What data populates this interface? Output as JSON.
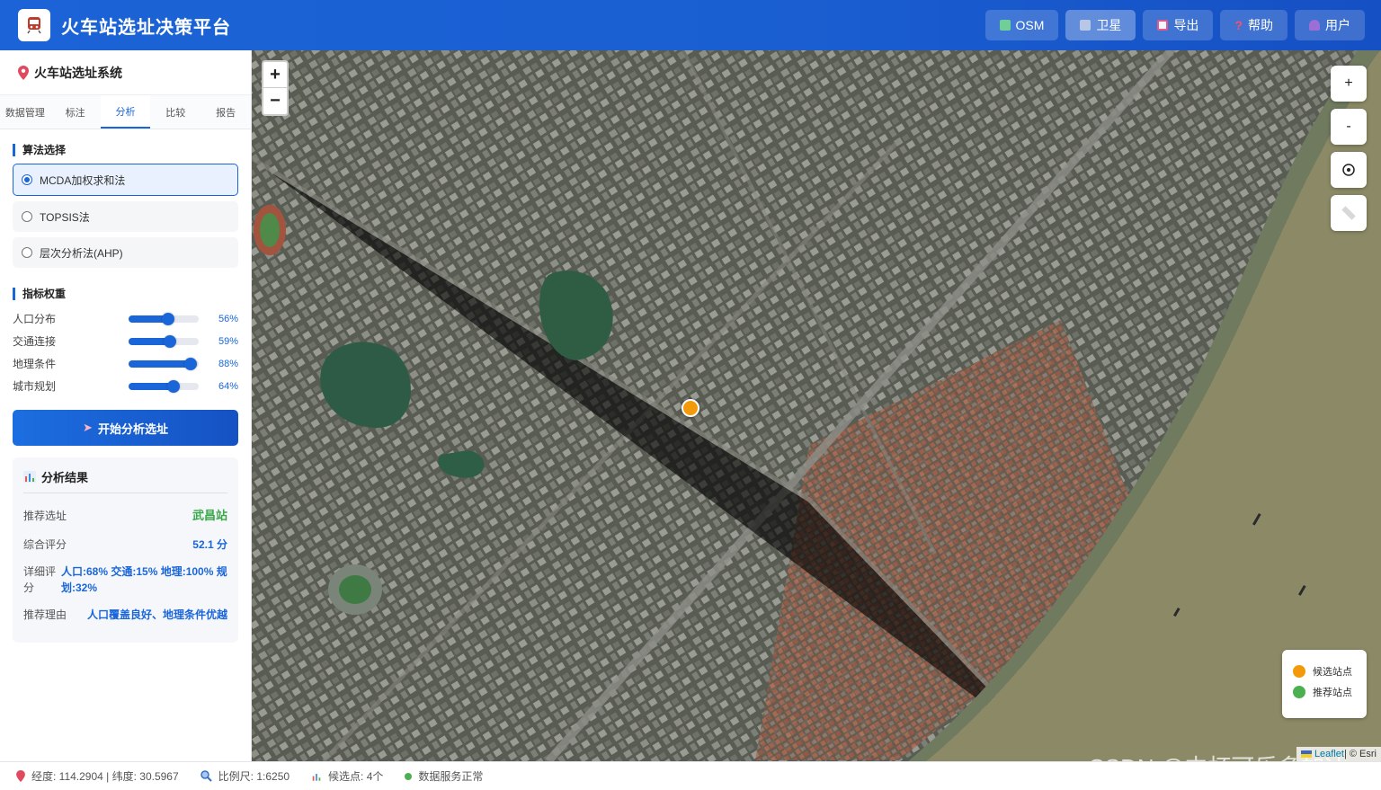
{
  "app": {
    "title": "火车站选址决策平台"
  },
  "header_buttons": [
    {
      "label": "OSM",
      "icon": "map-icon"
    },
    {
      "label": "卫星",
      "icon": "satellite-icon"
    },
    {
      "label": "导出",
      "icon": "export-icon"
    },
    {
      "label": "帮助",
      "icon": "help-icon"
    },
    {
      "label": "用户",
      "icon": "user-icon"
    }
  ],
  "sidebar": {
    "title": "火车站选址系统",
    "tabs": [
      "数据管理",
      "标注",
      "分析",
      "比较",
      "报告"
    ],
    "algo_section": "算法选择",
    "algorithms": [
      "MCDA加权求和法",
      "TOPSIS法",
      "层次分析法(AHP)"
    ],
    "weights_section": "指标权重",
    "weights": [
      {
        "label": "人口分布",
        "value_text": "56%",
        "value": 0.56
      },
      {
        "label": "交通连接",
        "value_text": "59%",
        "value": 0.59
      },
      {
        "label": "地理条件",
        "value_text": "88%",
        "value": 0.88
      },
      {
        "label": "城市规划",
        "value_text": "64%",
        "value": 0.64
      }
    ],
    "analyze_button": "开始分析选址",
    "result": {
      "title": "分析结果",
      "recommend_label": "推荐选址",
      "recommend_value": "武昌站",
      "score_label": "综合评分",
      "score_value": "52.1 分",
      "detail_label": "详细评分",
      "detail_value": "人口:68% 交通:15% 地理:100% 规划:32%",
      "reason_label": "推荐理由",
      "reason_value": "人口覆盖良好、地理条件优越"
    }
  },
  "map": {
    "zoom_in": "+",
    "zoom_out": "−",
    "ctl_zoom_in": "+",
    "ctl_zoom_out": "-",
    "legend": [
      {
        "label": "候选站点",
        "color": "#f39a0a"
      },
      {
        "label": "推荐站点",
        "color": "#4caf50"
      }
    ],
    "attribution_leaflet": "Leaflet",
    "attribution_rest": " | © Esri",
    "watermark": "CSDN @中杯可乐多加冰"
  },
  "status": {
    "coords": "经度: 114.2904 | 纬度: 30.5967",
    "scale": "比例尺: 1:6250",
    "candidates": "候选点: 4个",
    "service": "数据服务正常"
  }
}
